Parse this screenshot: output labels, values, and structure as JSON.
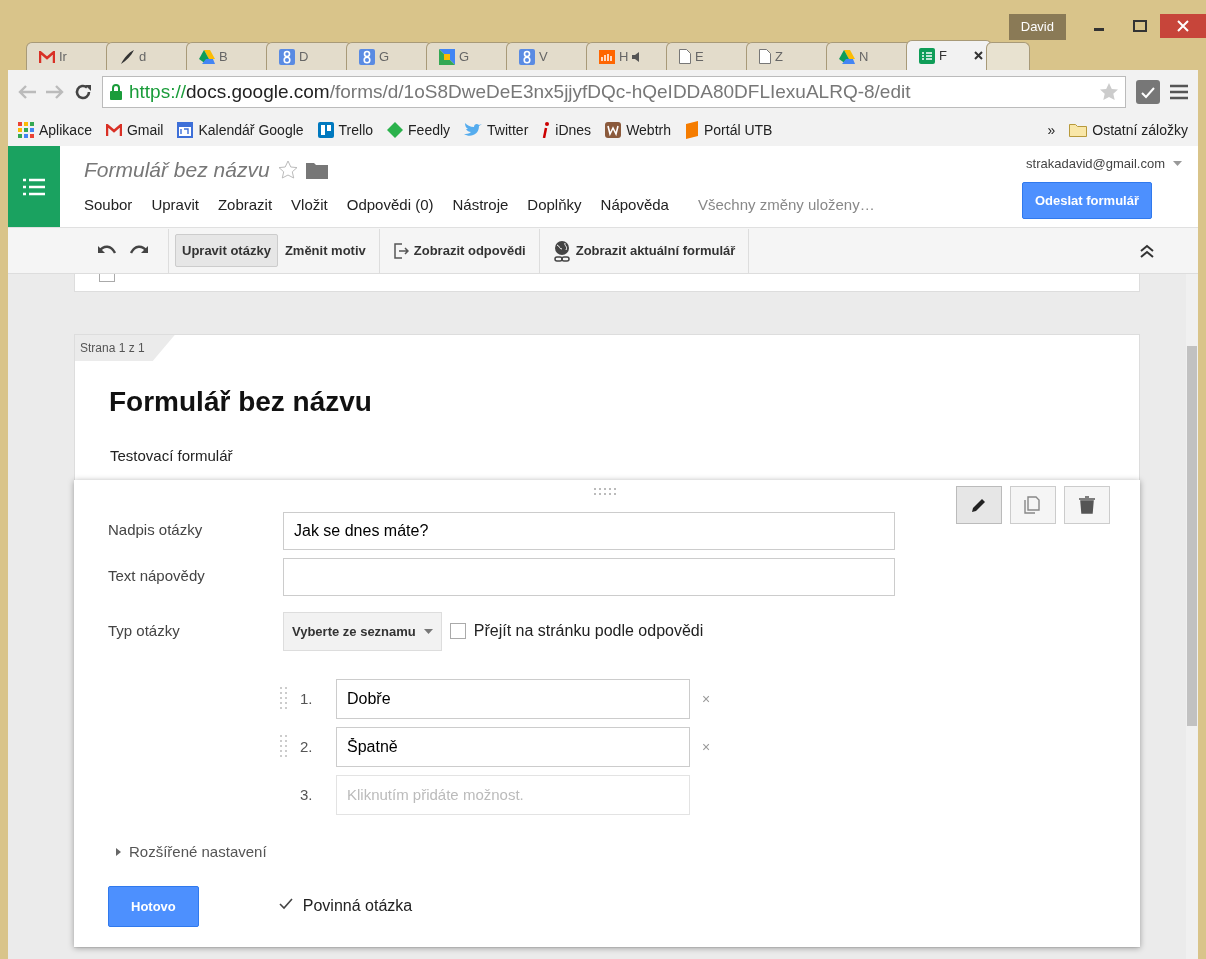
{
  "window": {
    "user": "David"
  },
  "tabs": [
    {
      "label": "Ir",
      "selected": false
    },
    {
      "label": "d",
      "selected": false
    },
    {
      "label": "B",
      "selected": false
    },
    {
      "label": "D",
      "selected": false
    },
    {
      "label": "G",
      "selected": false
    },
    {
      "label": "G",
      "selected": false
    },
    {
      "label": "V",
      "selected": false
    },
    {
      "label": "H",
      "selected": false
    },
    {
      "label": "E",
      "selected": false
    },
    {
      "label": "Z",
      "selected": false
    },
    {
      "label": "N",
      "selected": false
    },
    {
      "label": "F",
      "selected": true
    }
  ],
  "address": {
    "scheme": "https://",
    "host": "docs.google.com",
    "path": "/forms/d/1oS8DweDeE3nx5jjyfDQc-hQeIDDA80DFLIexuALRQ-8/edit"
  },
  "bookmarks": [
    {
      "label": "Aplikace"
    },
    {
      "label": "Gmail"
    },
    {
      "label": "Kalendář Google"
    },
    {
      "label": "Trello"
    },
    {
      "label": "Feedly"
    },
    {
      "label": "Twitter"
    },
    {
      "label": "iDnes"
    },
    {
      "label": "Webtrh"
    },
    {
      "label": "Portál UTB"
    }
  ],
  "bookmarks_more": "»",
  "other_bookmarks": "Ostatní záložky",
  "app": {
    "title": "Formulář bez názvu",
    "account": "strakadavid@gmail.com",
    "menu": [
      "Soubor",
      "Upravit",
      "Zobrazit",
      "Vložit",
      "Odpovědi (0)",
      "Nástroje",
      "Doplňky",
      "Nápověda"
    ],
    "save_status": "Všechny změny uloženy…",
    "send_button": "Odeslat formulář"
  },
  "toolbar": [
    {
      "label": "Upravit otázky",
      "kind": "text",
      "selected": true
    },
    {
      "label": "Změnit motiv",
      "kind": "text",
      "selected": false
    },
    {
      "label": "Zobrazit odpovědi",
      "kind": "export",
      "selected": false
    },
    {
      "label": "Zobrazit aktuální formulář",
      "kind": "globe",
      "selected": false
    }
  ],
  "previous_card": {
    "checkbox_checked": false
  },
  "page_tag": "Strana 1 z 1",
  "form": {
    "title": "Formulář bez názvu",
    "description": "Testovací formulář"
  },
  "question": {
    "fields": [
      {
        "label": "Nadpis otázky",
        "value": "Jak se dnes máte?"
      },
      {
        "label": "Text nápovědy"
      }
    ],
    "type_label": "Typ otázky",
    "type_value": "Vyberte ze seznamu",
    "go_to_page": {
      "label": "Přejít na stránku podle odpovědi",
      "checked": false
    },
    "options": [
      {
        "number": "1.",
        "value": "Dobře",
        "kind": "option"
      },
      {
        "number": "2.",
        "value": "Špatně",
        "kind": "option"
      },
      {
        "number": "3.",
        "placeholder": "Kliknutím přidáte možnost.",
        "kind": "add"
      }
    ],
    "remove_mark": "×",
    "advanced": "Rozšířené nastavení",
    "done_button": "Hotovo",
    "required": {
      "label": "Povinná otázka",
      "checked": true
    }
  }
}
